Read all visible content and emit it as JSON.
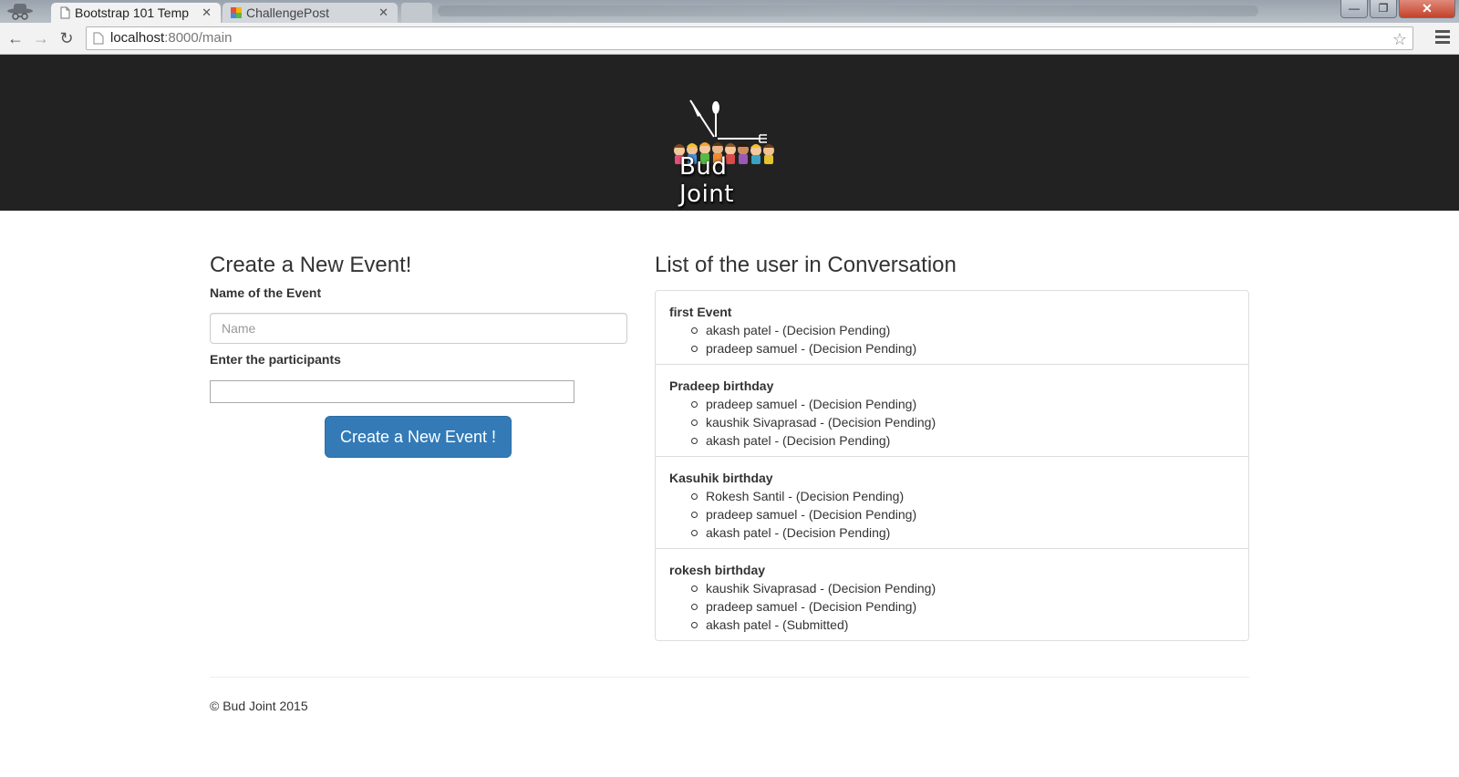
{
  "browser": {
    "tabs": [
      {
        "title": "Bootstrap 101 Temp",
        "icon": "document-icon",
        "active": true
      },
      {
        "title": "ChallengePost",
        "icon": "challengepost-favicon",
        "active": false
      }
    ],
    "close_glyph": "✕",
    "url_host": "localhost",
    "url_path": ":8000/main",
    "window_controls": {
      "minimize": "—",
      "maximize": "❐",
      "close": "✕"
    }
  },
  "header": {
    "logo_text": "Bud Joint"
  },
  "form": {
    "title": "Create a New Event!",
    "event_name_label": "Name of the Event",
    "event_name_placeholder": "Name",
    "event_name_value": "",
    "participants_label": "Enter the participants",
    "participants_value": "",
    "submit_label": "Create a New Event !"
  },
  "conversation": {
    "title": "List of the user in Conversation",
    "events": [
      {
        "name": "first Event",
        "participants": [
          "akash patel - (Decision Pending)",
          "pradeep samuel - (Decision Pending)"
        ]
      },
      {
        "name": "Pradeep birthday",
        "participants": [
          "pradeep samuel - (Decision Pending)",
          "kaushik Sivaprasad - (Decision Pending)",
          "akash patel - (Decision Pending)"
        ]
      },
      {
        "name": "Kasuhik birthday",
        "participants": [
          "Rokesh Santil - (Decision Pending)",
          "pradeep samuel - (Decision Pending)",
          "akash patel - (Decision Pending)"
        ]
      },
      {
        "name": "rokesh birthday",
        "participants": [
          "kaushik Sivaprasad - (Decision Pending)",
          "pradeep samuel - (Decision Pending)",
          "akash patel - (Submitted)"
        ]
      }
    ]
  },
  "footer": {
    "copyright": "© Bud Joint 2015"
  },
  "colors": {
    "header_bg": "#222222",
    "primary_button": "#337ab7",
    "text": "#333333"
  }
}
